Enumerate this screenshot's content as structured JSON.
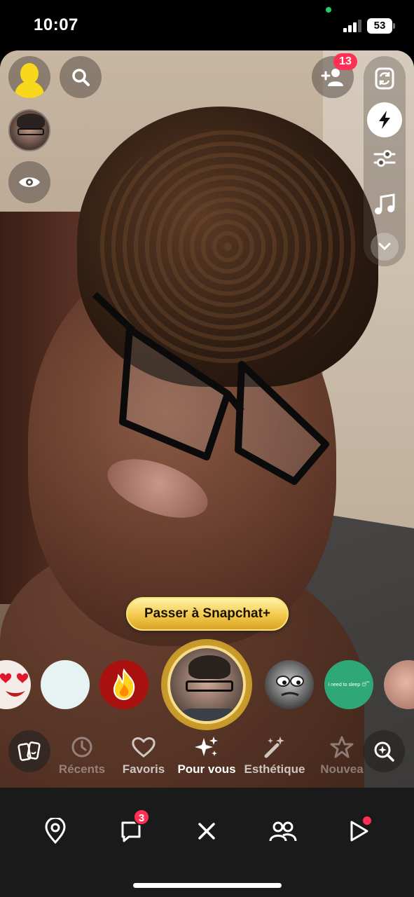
{
  "status": {
    "time": "10:07",
    "battery": "53"
  },
  "camera": {
    "friend_requests_badge": "13",
    "upgrade_button": "Passer à Snapchat+"
  },
  "lenses": {
    "green_lens_text": "i need to sleep 😴"
  },
  "categories": [
    {
      "label": "Récents",
      "icon": "history-icon",
      "state": "dim"
    },
    {
      "label": "Favoris",
      "icon": "heart-icon",
      "state": "mid"
    },
    {
      "label": "Pour vous",
      "icon": "sparkles-icon",
      "state": "active"
    },
    {
      "label": "Esthétique",
      "icon": "magic-wand-icon",
      "state": "mid"
    },
    {
      "label": "Nouvea",
      "icon": "star-icon",
      "state": "dim"
    }
  ],
  "bottom_nav": {
    "chat_badge": "3",
    "items": [
      "map",
      "chat",
      "close",
      "friends",
      "stories"
    ]
  },
  "colors": {
    "badge": "#ff2f55",
    "bitmoji": "#f8d81c",
    "plus_gold": "#f4c94a",
    "nav_bg": "#1a1a1a"
  }
}
